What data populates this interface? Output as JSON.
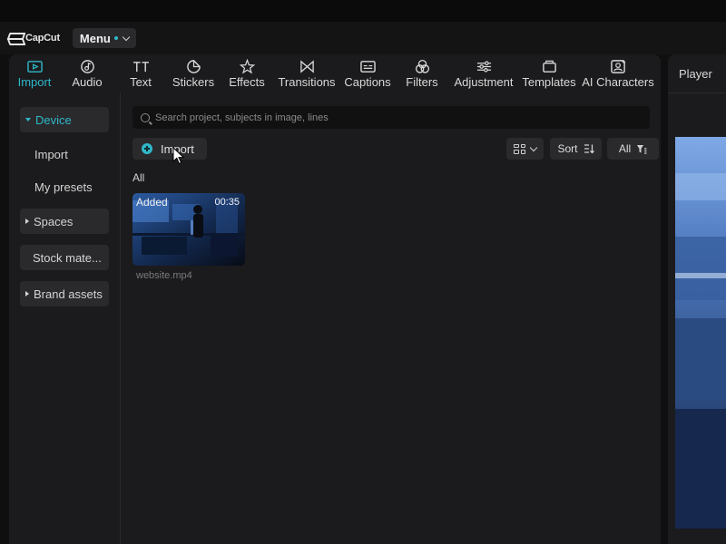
{
  "app": {
    "logo_text": "CapCut",
    "menu_label": "Menu",
    "accent_color": "#2fb8c9"
  },
  "toolbar": {
    "tabs": [
      {
        "label": "Import",
        "icon": "import-icon",
        "active": true
      },
      {
        "label": "Audio",
        "icon": "audio-icon"
      },
      {
        "label": "Text",
        "icon": "text-icon"
      },
      {
        "label": "Stickers",
        "icon": "sticker-icon"
      },
      {
        "label": "Effects",
        "icon": "effects-icon"
      },
      {
        "label": "Transitions",
        "icon": "transitions-icon"
      },
      {
        "label": "Captions",
        "icon": "captions-icon"
      },
      {
        "label": "Filters",
        "icon": "filters-icon"
      },
      {
        "label": "Adjustment",
        "icon": "adjustment-icon"
      },
      {
        "label": "Templates",
        "icon": "templates-icon"
      },
      {
        "label": "AI Characters",
        "icon": "ai-characters-icon"
      }
    ]
  },
  "sidebar": {
    "items": [
      {
        "label": "Device"
      },
      {
        "label": "Import"
      },
      {
        "label": "My presets"
      },
      {
        "label": "Spaces"
      },
      {
        "label": "Stock mate..."
      },
      {
        "label": "Brand assets"
      }
    ]
  },
  "media": {
    "search_placeholder": "Search project, subjects in image, lines",
    "import_label": "Import",
    "sort_label": "Sort",
    "filter_label": "All",
    "section_label": "All",
    "items": [
      {
        "badge": "Added",
        "duration": "00:35",
        "file_name": "website.mp4"
      }
    ]
  },
  "player": {
    "title": "Player"
  }
}
